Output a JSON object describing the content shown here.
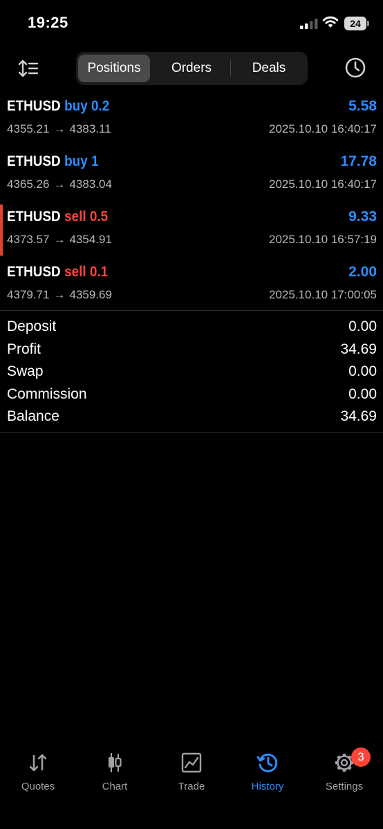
{
  "status": {
    "time": "19:25",
    "battery": "24"
  },
  "toolbar": {
    "tabs": [
      {
        "label": "Positions"
      },
      {
        "label": "Orders"
      },
      {
        "label": "Deals"
      }
    ],
    "active_tab": "Positions"
  },
  "positions": [
    {
      "symbol": "ETHUSD",
      "side": "buy 0.2",
      "type": "buy",
      "profit": "5.58",
      "open": "4355.21",
      "close": "4383.11",
      "arrow": "→",
      "date": "2025.10.10 16:40:17"
    },
    {
      "symbol": "ETHUSD",
      "side": "buy 1",
      "type": "buy",
      "profit": "17.78",
      "open": "4365.26",
      "close": "4383.04",
      "arrow": "→",
      "date": "2025.10.10 16:40:17"
    },
    {
      "symbol": "ETHUSD",
      "side": "sell 0.5",
      "type": "sell",
      "profit": "9.33",
      "open": "4373.57",
      "close": "4354.91",
      "arrow": "→",
      "date": "2025.10.10 16:57:19"
    },
    {
      "symbol": "ETHUSD",
      "side": "sell 0.1",
      "type": "sell",
      "profit": "2.00",
      "open": "4379.71",
      "close": "4359.69",
      "arrow": "→",
      "date": "2025.10.10 17:00:05"
    }
  ],
  "summary": [
    {
      "label": "Deposit",
      "value": "0.00"
    },
    {
      "label": "Profit",
      "value": "34.69"
    },
    {
      "label": "Swap",
      "value": "0.00"
    },
    {
      "label": "Commission",
      "value": "0.00"
    },
    {
      "label": "Balance",
      "value": "34.69"
    }
  ],
  "tabbar": {
    "items": [
      {
        "label": "Quotes",
        "icon": "quotes-arrows-icon"
      },
      {
        "label": "Chart",
        "icon": "candlestick-chart-icon"
      },
      {
        "label": "Trade",
        "icon": "trade-line-chart-icon"
      },
      {
        "label": "History",
        "icon": "history-clock-icon"
      },
      {
        "label": "Settings",
        "icon": "gear-icon"
      }
    ],
    "active": "History",
    "settings_badge": "3"
  },
  "colors": {
    "buy": "#2d8cff",
    "sell": "#ff453a",
    "accent": "#2d8cff",
    "background": "#000000"
  }
}
